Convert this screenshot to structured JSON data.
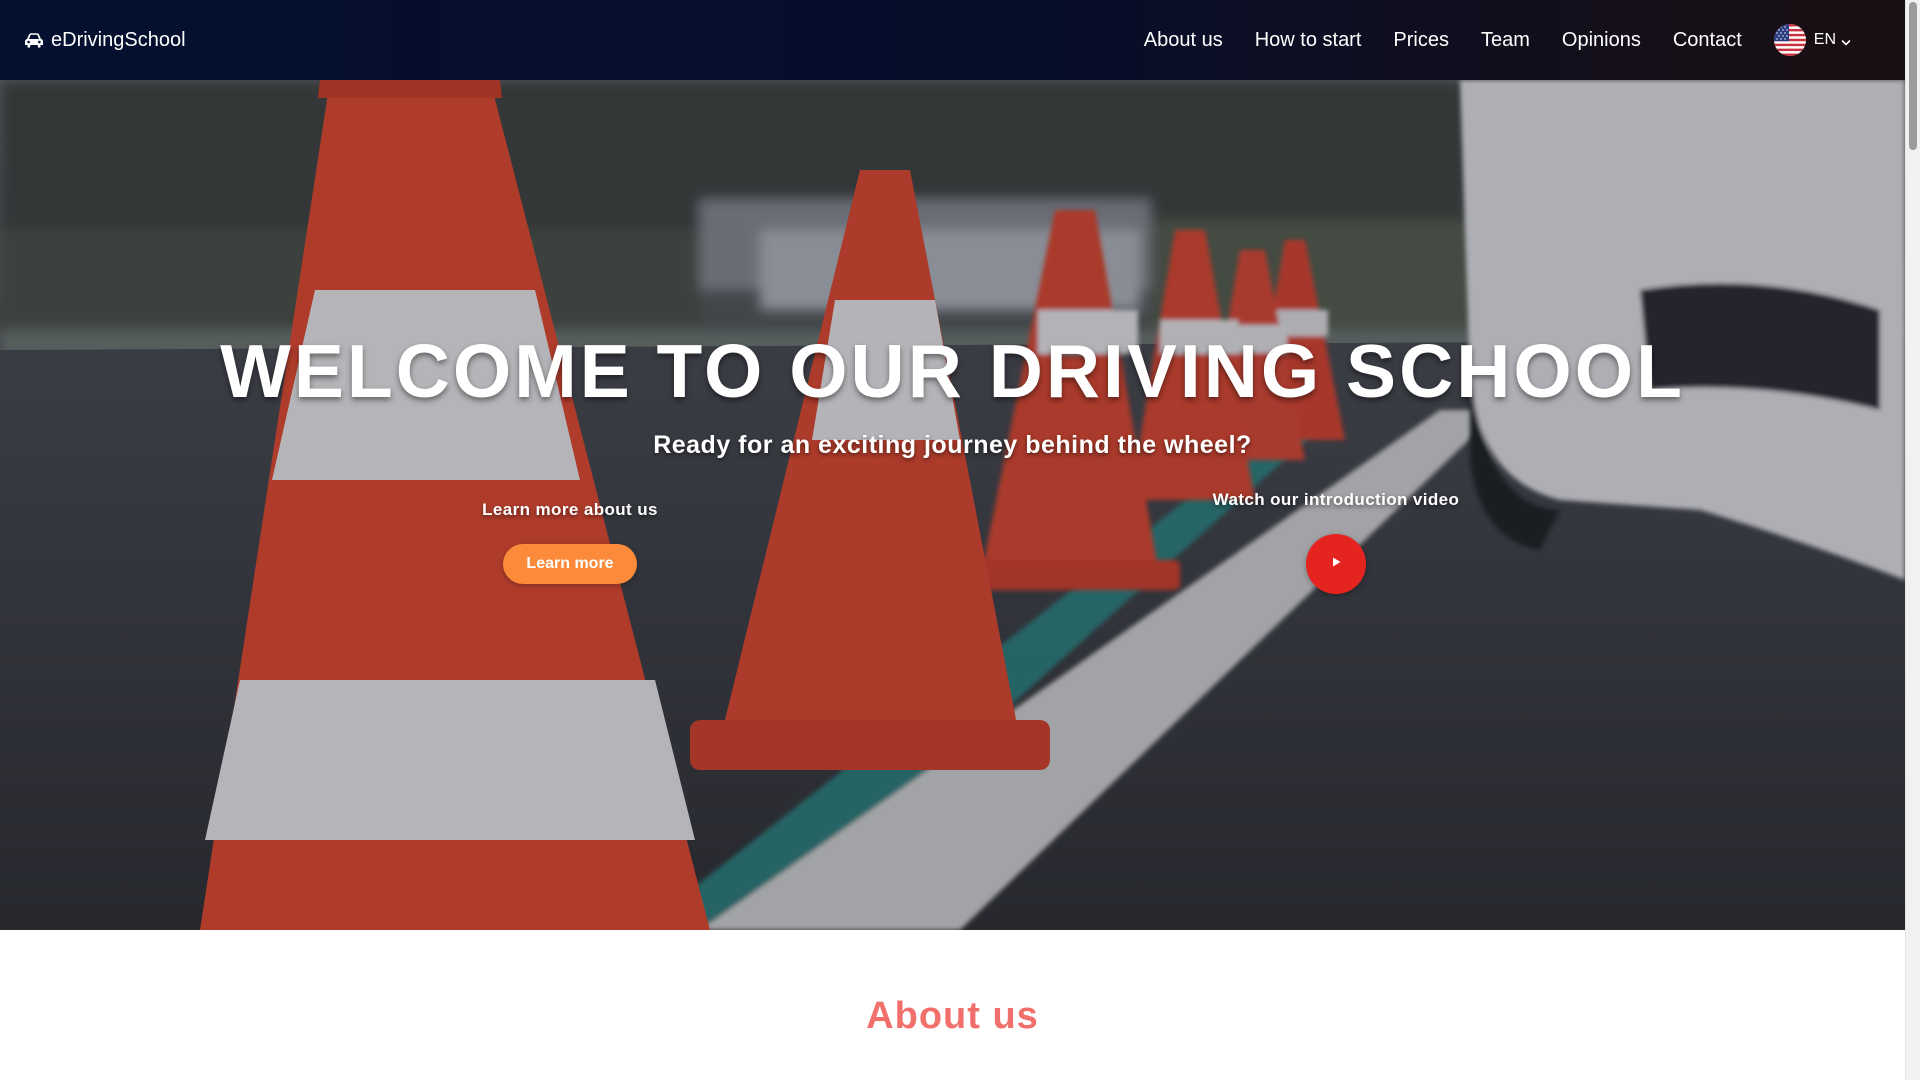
{
  "nav": {
    "brand": "eDrivingSchool",
    "links": [
      "About us",
      "How to start",
      "Prices",
      "Team",
      "Opinions",
      "Contact"
    ],
    "language": {
      "code": "EN",
      "flag_icon": "us-flag-icon"
    }
  },
  "hero": {
    "title": "WELCOME TO OUR DRIVING SCHOOL",
    "subtitle": "Ready for an exciting journey behind the wheel?",
    "learn_more": {
      "label": "Learn more about us",
      "button": "Learn more"
    },
    "video": {
      "label": "Watch our introduction video",
      "icon": "play-icon"
    }
  },
  "about": {
    "title": "About us"
  },
  "colors": {
    "nav_bg": "#04102f",
    "accent_orange": "#fb8b3a",
    "play_red": "#e52420",
    "section_title": "#f2706c"
  }
}
